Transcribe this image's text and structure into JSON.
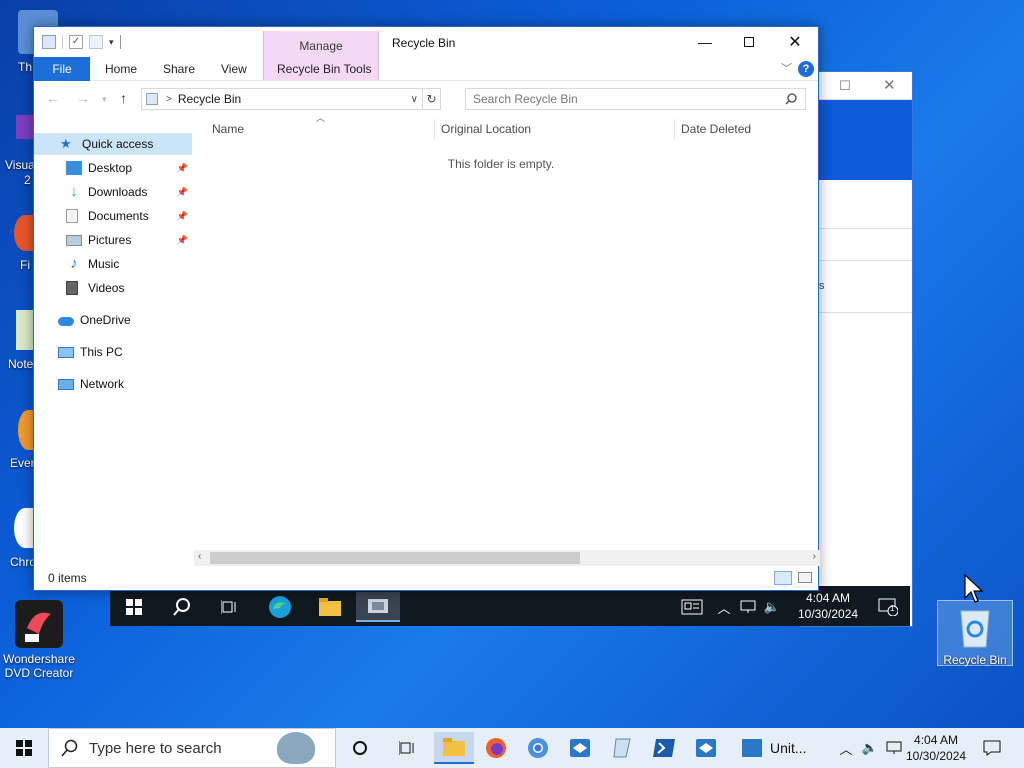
{
  "desktop": {
    "icons": [
      {
        "label": "Wondershare DVD Creator",
        "line1": "Wondershare",
        "line2": "DVD Creator"
      },
      {
        "label": "Recycle Bin"
      }
    ],
    "partial_labels": [
      "Th",
      "Visua",
      "2",
      "Fi",
      "Note",
      "Ever",
      "Chro"
    ]
  },
  "explorer": {
    "title": "Recycle Bin",
    "contextual_tab": "Manage",
    "ribbon_tabs": [
      "File",
      "Home",
      "Share",
      "View",
      "Recycle Bin Tools"
    ],
    "address": {
      "path": "Recycle Bin",
      "separator": ">"
    },
    "search": {
      "placeholder": "Search Recycle Bin"
    },
    "nav": {
      "quick_access": "Quick access",
      "items": [
        {
          "label": "Desktop",
          "icon": "desktop-folder-icon",
          "pinned": true
        },
        {
          "label": "Downloads",
          "icon": "downloads-folder-icon",
          "pinned": true
        },
        {
          "label": "Documents",
          "icon": "documents-folder-icon",
          "pinned": true
        },
        {
          "label": "Pictures",
          "icon": "pictures-folder-icon",
          "pinned": true
        },
        {
          "label": "Music",
          "icon": "music-folder-icon",
          "pinned": false
        },
        {
          "label": "Videos",
          "icon": "videos-folder-icon",
          "pinned": false
        }
      ],
      "onedrive": "OneDrive",
      "this_pc": "This PC",
      "network": "Network"
    },
    "columns": [
      "Name",
      "Original Location",
      "Date Deleted"
    ],
    "empty_message": "This folder is empty.",
    "status": "0 items"
  },
  "vm_taskbar": {
    "time": "4:04 AM",
    "date": "10/30/2024",
    "notification_count": "1"
  },
  "taskbar": {
    "search_placeholder": "Type here to search",
    "unity_label": "Unit...",
    "time": "4:04 AM",
    "date": "10/30/2024"
  },
  "colors": {
    "accent": "#1e6ed8",
    "manage_tab": "#f4d8f4",
    "selected_nav": "#cce4f7",
    "desktop_bg": "#0b5ed8"
  }
}
